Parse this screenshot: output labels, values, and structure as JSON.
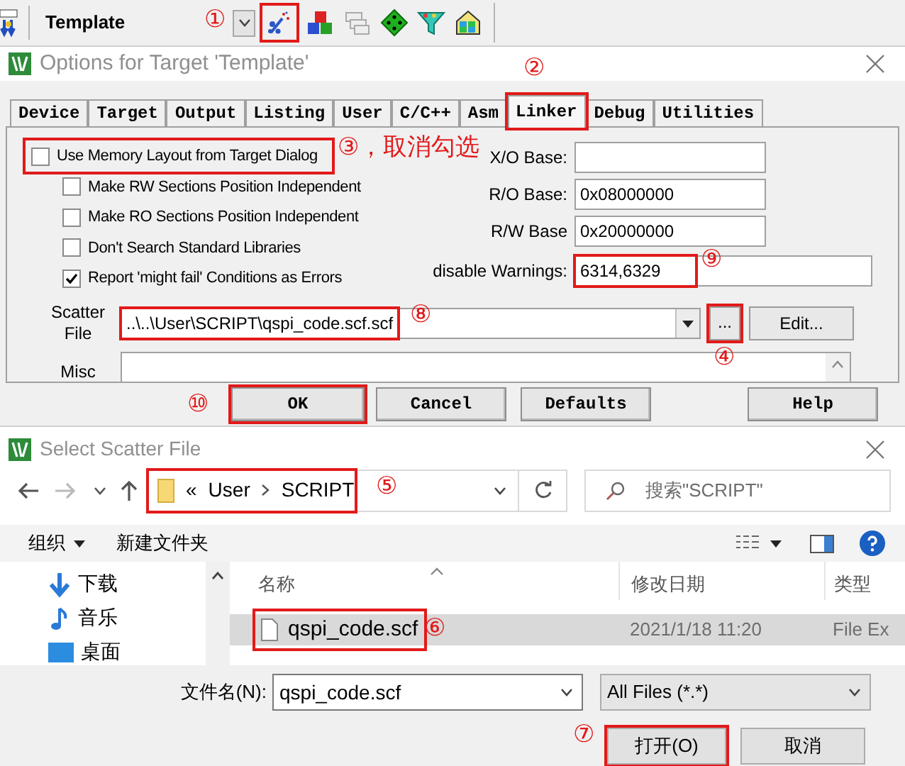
{
  "toolbar": {
    "target": "Template",
    "options_button": {
      "highlighted": true
    }
  },
  "options_dialog": {
    "title": "Options for Target 'Template'",
    "tabs": [
      {
        "label": "Device",
        "selected": false,
        "highlighted": false
      },
      {
        "label": "Target",
        "selected": false,
        "highlighted": false
      },
      {
        "label": "Output",
        "selected": false,
        "highlighted": false
      },
      {
        "label": "Listing",
        "selected": false,
        "highlighted": false
      },
      {
        "label": "User",
        "selected": false,
        "highlighted": false
      },
      {
        "label": "C/C++",
        "selected": false,
        "highlighted": false
      },
      {
        "label": "Asm",
        "selected": false,
        "highlighted": false
      },
      {
        "label": "Linker",
        "selected": true,
        "highlighted": true
      },
      {
        "label": "Debug",
        "selected": false,
        "highlighted": false
      },
      {
        "label": "Utilities",
        "selected": false,
        "highlighted": false
      }
    ],
    "checkboxes": [
      {
        "label": "Use Memory Layout from Target Dialog",
        "checked": false,
        "highlighted": true
      },
      {
        "label": "Make RW Sections Position Independent",
        "checked": false,
        "highlighted": false
      },
      {
        "label": "Make RO Sections Position Independent",
        "checked": false,
        "highlighted": false
      },
      {
        "label": "Don't Search Standard Libraries",
        "checked": false,
        "highlighted": false
      },
      {
        "label": "Report 'might fail' Conditions as Errors",
        "checked": true,
        "highlighted": false
      }
    ],
    "address_fields": [
      {
        "label": "X/O Base:"
      },
      {
        "label": "R/O Base:",
        "value": "0x08000000"
      },
      {
        "label": "R/W Base",
        "value": "0x20000000"
      }
    ],
    "warnings": {
      "label": "disable Warnings:",
      "value": "6314,6329",
      "highlighted": true
    },
    "scatter_file": {
      "label": "Scatter File",
      "value": "..\\..\\User\\SCRIPT\\qspi_code.scf.scf",
      "highlighted": true
    },
    "browse_button": {
      "label": "...",
      "highlighted": true
    },
    "edit_button": {
      "label": "Edit..."
    },
    "misc": {
      "label": "Misc"
    },
    "buttons": [
      {
        "label": "OK",
        "highlighted": true
      },
      {
        "label": "Cancel",
        "highlighted": false
      },
      {
        "label": "Defaults",
        "highlighted": false
      },
      {
        "label": "Help",
        "highlighted": false
      }
    ]
  },
  "file_dialog": {
    "title": "Select Scatter File",
    "breadcrumb": {
      "overflow": "«",
      "path": [
        "User",
        "SCRIPT"
      ],
      "highlighted": true
    },
    "search": {
      "placeholder": "搜索\"SCRIPT\""
    },
    "commands": [
      {
        "label": "组织",
        "dropdown": true
      },
      {
        "label": "新建文件夹",
        "dropdown": false
      }
    ],
    "nav_items": [
      {
        "label": "下载",
        "kind": "downloads"
      },
      {
        "label": "音乐",
        "kind": "music"
      },
      {
        "label": "桌面",
        "kind": "desktop"
      }
    ],
    "columns": [
      "名称",
      "修改日期",
      "类型"
    ],
    "files": [
      {
        "name": "qspi_code.scf",
        "date": "2021/1/18 11:20",
        "type": "File Ex",
        "selected": true,
        "highlighted": true
      }
    ],
    "file_name": {
      "label": "文件名(N):",
      "value": "qspi_code.scf"
    },
    "file_type": "All Files (*.*)",
    "buttons": [
      {
        "label": "打开(O)",
        "highlighted": true
      },
      {
        "label": "取消",
        "highlighted": false
      }
    ]
  },
  "annotations": [
    {
      "text": "①"
    },
    {
      "text": "②"
    },
    {
      "text": "③，取消勾选"
    },
    {
      "text": "④"
    },
    {
      "text": "⑤"
    },
    {
      "text": "⑥"
    },
    {
      "text": "⑦"
    },
    {
      "text": "⑧"
    },
    {
      "text": "⑨"
    },
    {
      "text": "⑩"
    }
  ]
}
